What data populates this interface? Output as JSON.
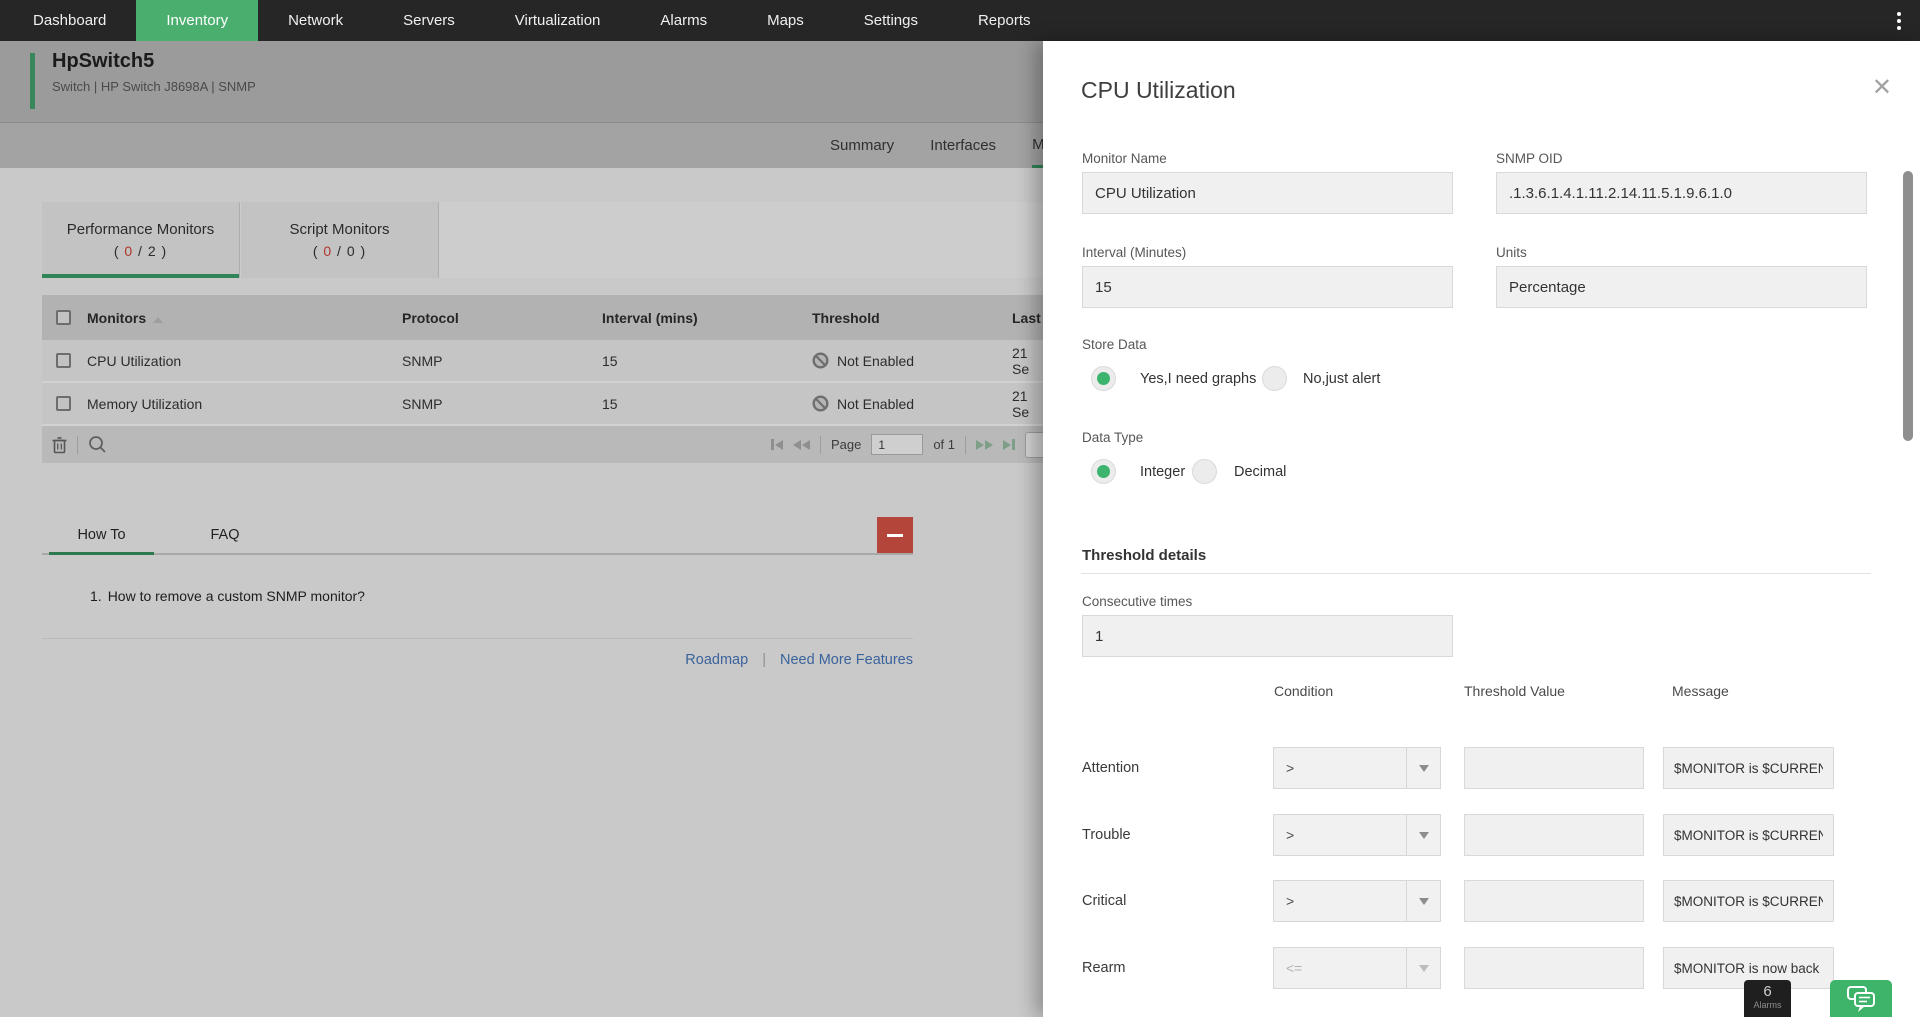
{
  "colors": {
    "nav_green": "#4aaf6e",
    "panel_green": "#3cb46d",
    "dimmed_green": "#2f8557",
    "alert_red": "#b0362b",
    "link_blue": "#3b639c",
    "remove_button_red": "#b4453b"
  },
  "topnav": {
    "items": [
      {
        "label": "Dashboard",
        "active": false
      },
      {
        "label": "Inventory",
        "active": true
      },
      {
        "label": "Network",
        "active": false
      },
      {
        "label": "Servers",
        "active": false
      },
      {
        "label": "Virtualization",
        "active": false
      },
      {
        "label": "Alarms",
        "active": false
      },
      {
        "label": "Maps",
        "active": false
      },
      {
        "label": "Settings",
        "active": false
      },
      {
        "label": "Reports",
        "active": false
      }
    ]
  },
  "device_header": {
    "name": "HpSwitch5",
    "meta": "Switch | HP Switch J8698A  | SNMP"
  },
  "page_tabs": {
    "items": [
      {
        "label": "Summary",
        "active": false
      },
      {
        "label": "Interfaces",
        "active": false
      },
      {
        "label": "Mo",
        "active": true
      }
    ]
  },
  "monitor_tabs": {
    "tabs": [
      {
        "label": "Performance Monitors",
        "count_open": "( ",
        "count_alert": "0",
        "count_rest": " / 2 )",
        "active": true
      },
      {
        "label": "Script Monitors",
        "count_open": "( ",
        "count_alert": "0",
        "count_rest": " / 0 )",
        "active": false
      }
    ]
  },
  "monitors_table": {
    "headers": {
      "monitors": "Monitors",
      "protocol": "Protocol",
      "interval": "Interval (mins)",
      "threshold": "Threshold",
      "last": "Last"
    },
    "rows": [
      {
        "name": "CPU Utilization",
        "protocol": "SNMP",
        "interval": "15",
        "threshold": "Not Enabled",
        "last": "21 Se"
      },
      {
        "name": "Memory Utilization",
        "protocol": "SNMP",
        "interval": "15",
        "threshold": "Not Enabled",
        "last": "21 Se"
      }
    ],
    "pagination": {
      "page_label": "Page",
      "page_value": "1",
      "of_label": "of 1"
    }
  },
  "help": {
    "tabs": [
      {
        "label": "How To",
        "active": true
      },
      {
        "label": "FAQ",
        "active": false
      }
    ],
    "items": [
      {
        "num": "1.",
        "text": "How to remove a custom SNMP monitor?"
      }
    ],
    "links": {
      "roadmap": "Roadmap",
      "sep": "|",
      "more": "Need More Features"
    }
  },
  "panel": {
    "title": "CPU Utilization",
    "close_glyph": "✕",
    "fields": {
      "monitor_name": {
        "label": "Monitor Name",
        "value": "CPU Utilization"
      },
      "snmp_oid": {
        "label": "SNMP OID",
        "value": ".1.3.6.1.4.1.11.2.14.11.5.1.9.6.1.0"
      },
      "interval": {
        "label": "Interval (Minutes)",
        "value": "15"
      },
      "units": {
        "label": "Units",
        "value": "Percentage"
      }
    },
    "store_data": {
      "label": "Store Data",
      "options": [
        {
          "label": "Yes,I need graphs",
          "selected": true
        },
        {
          "label": "No,just alert",
          "selected": false
        }
      ]
    },
    "data_type": {
      "label": "Data Type",
      "options": [
        {
          "label": "Integer",
          "selected": true
        },
        {
          "label": "Decimal",
          "selected": false
        }
      ]
    },
    "threshold": {
      "section_title": "Threshold details",
      "consecutive_label": "Consecutive times",
      "consecutive_value": "1",
      "headers": {
        "condition": "Condition",
        "value": "Threshold Value",
        "message": "Message"
      },
      "rows": [
        {
          "label": "Attention",
          "condition": ">",
          "value": "",
          "message": "$MONITOR is $CURREN",
          "disabled": false
        },
        {
          "label": "Trouble",
          "condition": ">",
          "value": "",
          "message": "$MONITOR is $CURREN",
          "disabled": false
        },
        {
          "label": "Critical",
          "condition": ">",
          "value": "",
          "message": "$MONITOR is $CURREN",
          "disabled": false
        },
        {
          "label": "Rearm",
          "condition": "<=",
          "value": "",
          "message": "$MONITOR is now back",
          "disabled": true
        }
      ]
    }
  },
  "floating": {
    "alarm_count": "6",
    "alarm_label": "Alarms"
  }
}
